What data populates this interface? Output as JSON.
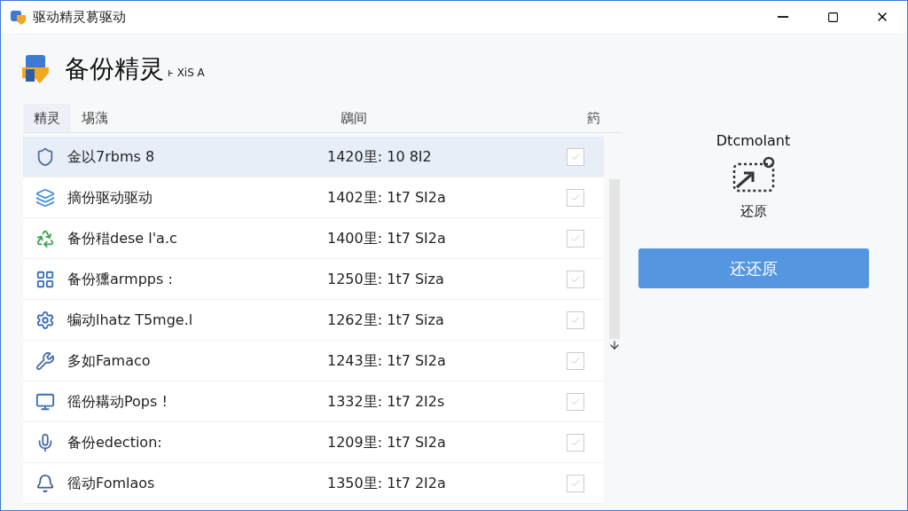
{
  "window": {
    "title": "驱动精灵䓪驱动"
  },
  "header": {
    "title": "备份精灵",
    "subtitle": "ͱ XiS A"
  },
  "tabs": [
    {
      "label": "精灵",
      "selected": true
    },
    {
      "label": "埸蕅",
      "selected": false
    }
  ],
  "table": {
    "columns": {
      "column_3": "鶋间",
      "column_4": "箹"
    },
    "rows": [
      {
        "name": "金以7rbms 8",
        "time": "1420里: 10 8I2",
        "selected": true,
        "checked": false
      },
      {
        "name": "摘份驱动驱动",
        "time": "1402里: 1t7 SI2a",
        "selected": false,
        "checked": false
      },
      {
        "name": "备份稓dese l'a.c",
        "time": "1400里: 1t7 SI2a",
        "selected": false,
        "checked": false
      },
      {
        "name": "备份獯armpps :",
        "time": "1250里: 1t7 Siza",
        "selected": false,
        "checked": false
      },
      {
        "name": "犏动lhatz T5mge.l",
        "time": "1262里: 1t7 Siza",
        "selected": false,
        "checked": false
      },
      {
        "name": "多如Famaco",
        "time": "1243里: 1t7 SI2a",
        "selected": false,
        "checked": false
      },
      {
        "name": "徭份耩动Pops !",
        "time": "1332里: 1t7 2I2s",
        "selected": false,
        "checked": false
      },
      {
        "name": "备份edection:",
        "time": "1209里: 1t7 SI2a",
        "selected": false,
        "checked": false
      },
      {
        "name": "徭动Fomlaos",
        "time": "1350里: 1t7 2I2a",
        "selected": false,
        "checked": false
      }
    ]
  },
  "restore_panel": {
    "heading": "Dtcmolant",
    "label": "还原",
    "button": "还还原"
  }
}
